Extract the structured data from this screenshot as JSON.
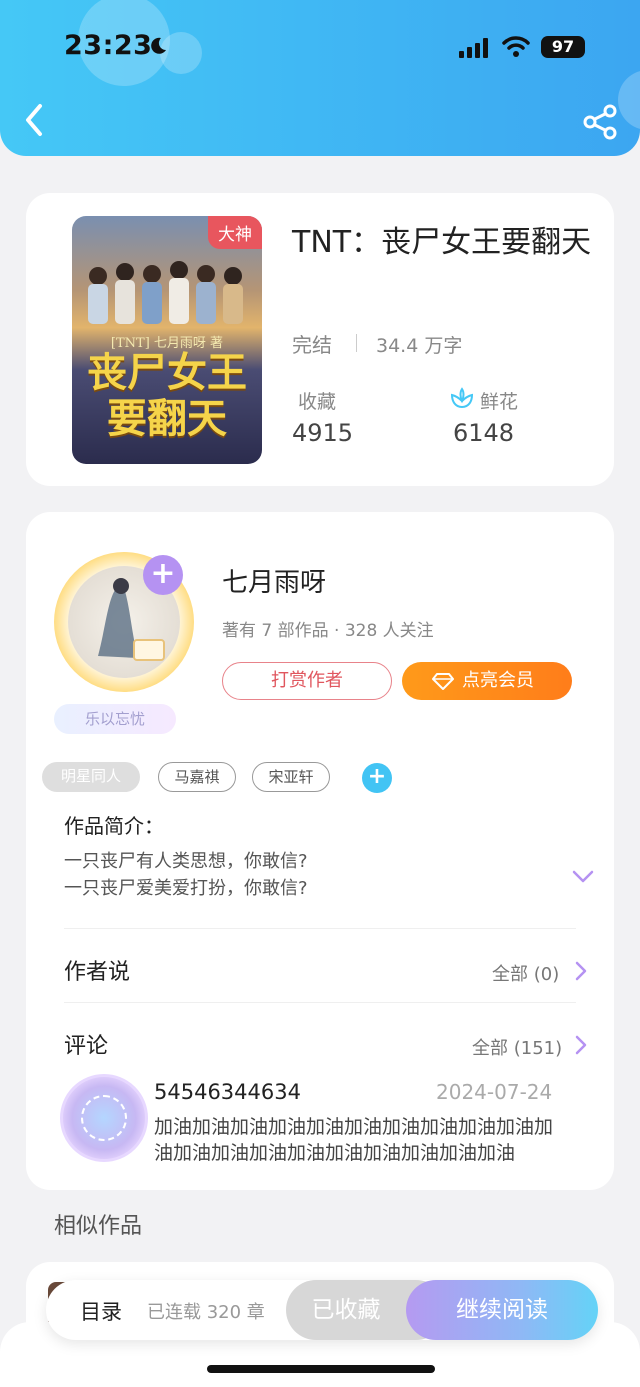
{
  "status_bar": {
    "time": "23:23",
    "battery": "97"
  },
  "header": {
    "back_icon": "chevron-left-icon",
    "share_icon": "share-icon",
    "color": "#45c8f6"
  },
  "book": {
    "cover_tag": "大神",
    "cover_subtitle": "[TNT] 七月雨呀 著",
    "cover_title_line1": "丧尸女王",
    "cover_title_line2": "要翻天",
    "title": "TNT：丧尸女王要翻天",
    "status": "完结",
    "word_count": "34.4 万字",
    "favorites_label": "收藏",
    "favorites_value": "4915",
    "flowers_label": "鲜花",
    "flowers_value": "6148"
  },
  "author": {
    "name": "七月雨呀",
    "meta": "著有 7 部作品 · 328 人关注",
    "tag": "乐以忘忧",
    "tip_label": "打赏作者",
    "vip_label": "点亮会员"
  },
  "tags": [
    "明星同人",
    "马嘉祺",
    "宋亚轩"
  ],
  "intro": {
    "title": "作品简介：",
    "line1": "一只丧尸有人类思想，你敢信?",
    "line2": "一只丧尸爱美爱打扮，你敢信?"
  },
  "author_says": {
    "title": "作者说",
    "link": "全部 (0)"
  },
  "comments": {
    "title": "评论",
    "link": "全部 (151)",
    "items": [
      {
        "user": "54546344634",
        "date": "2024-07-24",
        "text": "加油加油加油加油加油加油加油加油加油加油加油加油加油加油加油加油加油加油加油加油"
      }
    ]
  },
  "similar": {
    "title": "相似作品"
  },
  "bottom": {
    "toc": "目录",
    "serial": "已连载 320 章",
    "collected": "已收藏",
    "continue": "继续阅读"
  }
}
